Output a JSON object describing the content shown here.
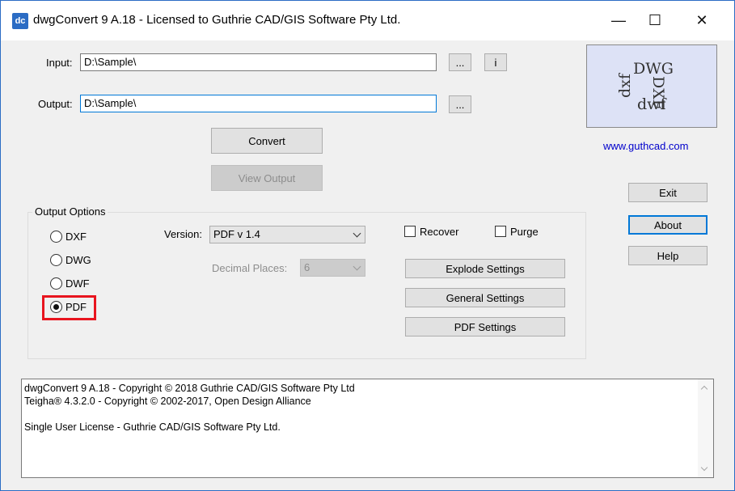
{
  "window": {
    "icon_text": "dc",
    "title": "dwgConvert 9 A.18 - Licensed to Guthrie CAD/GIS Software Pty Ltd.",
    "minimize": "—",
    "maximize": "☐",
    "close": "✕"
  },
  "input": {
    "label": "Input:",
    "value": "D:\\Sample\\",
    "browse_label": "...",
    "info_label": "i"
  },
  "output": {
    "label": "Output:",
    "value": "D:\\Sample\\",
    "browse_label": "..."
  },
  "actions": {
    "convert_label": "Convert",
    "view_output_label": "View Output"
  },
  "logo": {
    "dwg": "DWG",
    "dxf": "DXF",
    "dxf_lower": "dxf",
    "dwf": "dwf"
  },
  "website": "www.guthcad.com",
  "side_buttons": {
    "exit": "Exit",
    "about": "About",
    "help": "Help"
  },
  "output_options": {
    "group_title": "Output Options",
    "formats": [
      {
        "label": "DXF",
        "selected": false
      },
      {
        "label": "DWG",
        "selected": false
      },
      {
        "label": "DWF",
        "selected": false
      },
      {
        "label": "PDF",
        "selected": true
      }
    ],
    "version_label": "Version:",
    "version_value": "PDF v 1.4",
    "decimal_places_label": "Decimal Places:",
    "decimal_places_value": "6",
    "recover_label": "Recover",
    "purge_label": "Purge",
    "explode_settings_label": "Explode Settings",
    "general_settings_label": "General Settings",
    "pdf_settings_label": "PDF Settings"
  },
  "log_lines": [
    "dwgConvert 9 A.18 - Copyright © 2018 Guthrie CAD/GIS Software Pty Ltd",
    "Teigha® 4.3.2.0 - Copyright © 2002-2017, Open Design Alliance",
    "",
    "Single User License - Guthrie CAD/GIS Software Pty Ltd."
  ],
  "colors": {
    "accent": "#0078d7",
    "highlight": "#e8141e",
    "logo_bg": "#dde2f6",
    "link": "#0000cc"
  }
}
